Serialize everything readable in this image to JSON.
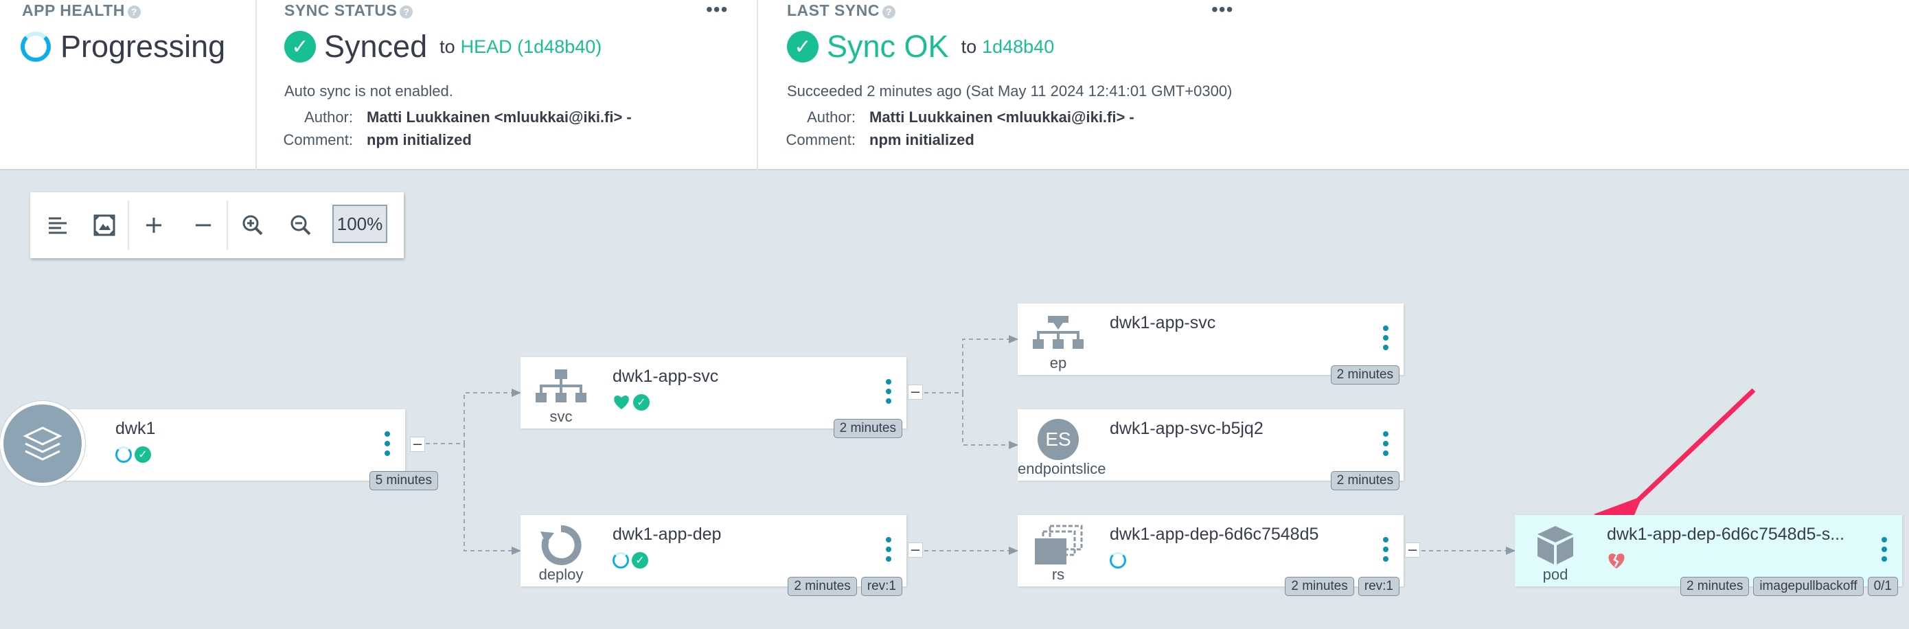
{
  "app_health": {
    "title": "APP HEALTH",
    "help": "?",
    "status": "Progressing"
  },
  "sync_status": {
    "title": "SYNC STATUS",
    "help": "?",
    "menu": "•••",
    "status": "Synced",
    "to": "to",
    "revision": "HEAD (1d48b40)",
    "auto_sync": "Auto sync is not enabled.",
    "author_label": "Author:",
    "author": "Matti Luukkainen <mluukkai@iki.fi> -",
    "comment_label": "Comment:",
    "comment": "npm initialized"
  },
  "last_sync": {
    "title": "LAST SYNC",
    "help": "?",
    "menu": "•••",
    "status": "Sync OK",
    "to": "to",
    "revision": "1d48b40",
    "result": "Succeeded 2 minutes ago (Sat May 11 2024 12:41:01 GMT+0300)",
    "author_label": "Author:",
    "author": "Matti Luukkainen <mluukkai@iki.fi> -",
    "comment_label": "Comment:",
    "comment": "npm initialized"
  },
  "toolbar": {
    "zoom": "100%"
  },
  "colors": {
    "accent": "#18be94",
    "progress": "#0dadea",
    "kebab": "#0e90a8",
    "degraded": "#e96d76",
    "highlight": "#e0fbfb",
    "arrow": "#f4285f"
  },
  "graph": {
    "app": {
      "name": "dwk1",
      "age": "5 minutes",
      "collapse": "–"
    },
    "svc": {
      "name": "dwk1-app-svc",
      "kind": "svc",
      "age": "2 minutes",
      "collapse": "–"
    },
    "deploy": {
      "name": "dwk1-app-dep",
      "kind": "deploy",
      "age": "2 minutes",
      "rev": "rev:1",
      "collapse": "–"
    },
    "ep": {
      "name": "dwk1-app-svc",
      "kind": "ep",
      "age": "2 minutes"
    },
    "endpointslice": {
      "name": "dwk1-app-svc-b5jq2",
      "kind": "endpointslice",
      "icon_text": "ES",
      "age": "2 minutes"
    },
    "rs": {
      "name": "dwk1-app-dep-6d6c7548d5",
      "kind": "rs",
      "age": "2 minutes",
      "rev": "rev:1",
      "collapse": "–"
    },
    "pod": {
      "name": "dwk1-app-dep-6d6c7548d5-s...",
      "kind": "pod",
      "age": "2 minutes",
      "reason": "imagepullbackoff",
      "ready": "0/1"
    }
  }
}
